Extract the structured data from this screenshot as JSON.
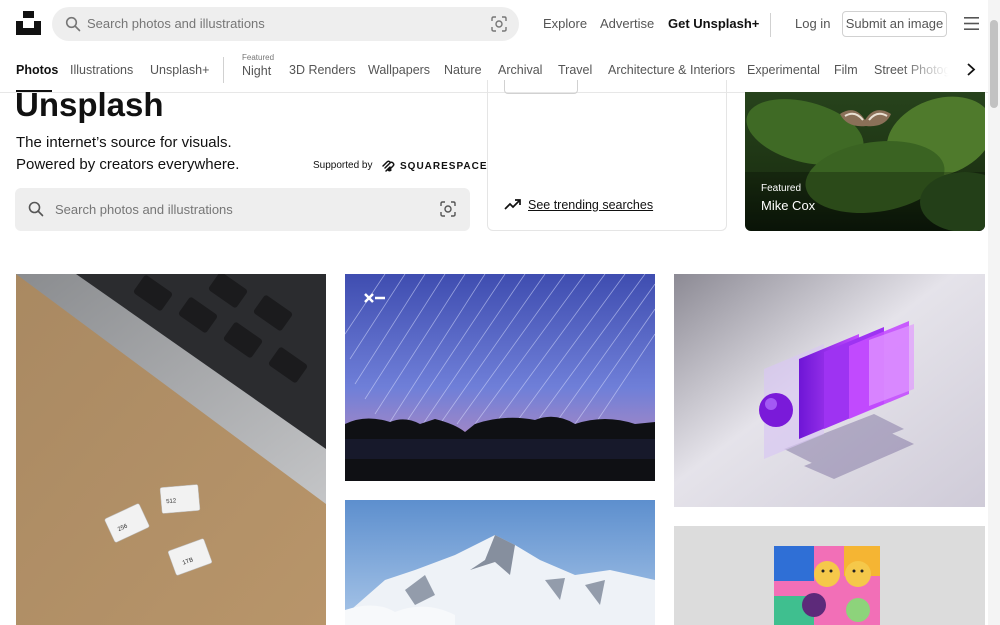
{
  "header": {
    "search_placeholder": "Search photos and illustrations",
    "nav": {
      "explore": "Explore",
      "advertise": "Advertise",
      "get_plus": "Get Unsplash+",
      "login": "Log in",
      "submit": "Submit an image"
    }
  },
  "categories": {
    "primary": [
      "Photos",
      "Illustrations",
      "Unsplash+"
    ],
    "active": "Photos",
    "featured_label": "Featured",
    "topics": [
      "Night",
      "3D Renders",
      "Wallpapers",
      "Nature",
      "Archival",
      "Travel",
      "Architecture & Interiors",
      "Experimental",
      "Film",
      "Street Photogra"
    ]
  },
  "hero": {
    "title": "Unsplash",
    "line1": "The internet’s source for visuals.",
    "line2": "Powered by creators everywhere.",
    "supported_by": "Supported by",
    "sponsor": "SQUARESPACE",
    "search_placeholder": "Search photos and illustrations",
    "trending_link": "See trending searches",
    "featured": {
      "label": "Featured",
      "author": "Mike Cox"
    }
  },
  "colors": {
    "text": "#111111",
    "muted": "#767676",
    "search_bg": "#eeeeee",
    "border": "#d1d1d1"
  },
  "icons": [
    "unsplash-logo",
    "search-icon",
    "visual-search-icon",
    "menu-icon",
    "chevron-right-icon",
    "trending-icon",
    "squarespace-logo",
    "unsplash-plus-icon"
  ]
}
